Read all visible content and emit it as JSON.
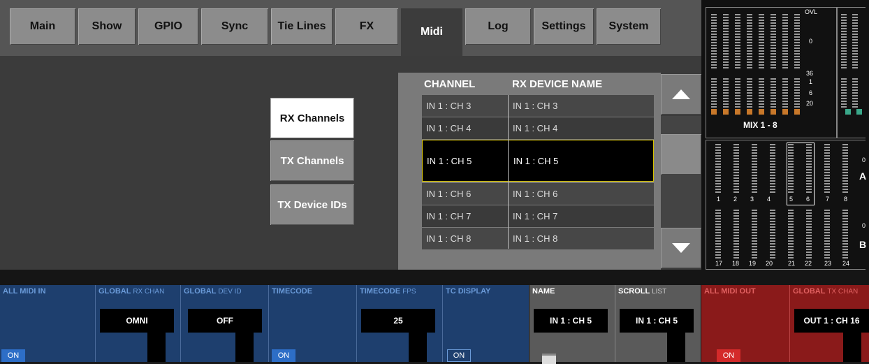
{
  "tabs": [
    "Main",
    "Show",
    "GPIO",
    "Sync",
    "Tie Lines",
    "FX",
    "Midi",
    "Log",
    "Settings",
    "System"
  ],
  "active_tab": "Midi",
  "side_buttons": [
    "RX Channels",
    "TX Channels",
    "TX Device IDs"
  ],
  "list": {
    "col_channel": "CHANNEL",
    "col_rx_name": "RX DEVICE NAME",
    "rows": [
      {
        "channel": "IN 1 : CH 3",
        "name": "IN 1 : CH 3"
      },
      {
        "channel": "IN 1 : CH 4",
        "name": "IN 1 : CH 4"
      },
      {
        "channel": "IN 1 : CH 5",
        "name": "IN 1 : CH 5"
      },
      {
        "channel": "IN 1 : CH 6",
        "name": "IN 1 : CH 6"
      },
      {
        "channel": "IN 1 : CH 7",
        "name": "IN 1 : CH 7"
      },
      {
        "channel": "IN 1 : CH 8",
        "name": "IN 1 : CH 8"
      }
    ],
    "selected_row": "IN 1 : CH 5"
  },
  "meters": {
    "mix_label": "MIX 1 - 8",
    "scale_top": [
      "OVL",
      "0",
      "36",
      "1",
      "6",
      "20"
    ],
    "row_a_nums": [
      "1",
      "2",
      "3",
      "4",
      "5",
      "6",
      "7",
      "8"
    ],
    "row_b_nums": [
      "17",
      "18",
      "19",
      "20",
      "21",
      "22",
      "23",
      "24"
    ],
    "row_a_letter": "A",
    "row_b_letter": "B",
    "tick_zero": "0"
  },
  "bottom": {
    "all_midi_in": "ALL MIDI IN",
    "global_rx_chan": "GLOBAL",
    "global_rx_chan_sub": "RX CHAN",
    "global_rx_chan_value": "OMNI",
    "global_dev_id": "GLOBAL",
    "global_dev_id_sub": "DEV ID",
    "global_dev_id_value": "OFF",
    "timecode": "TIMECODE",
    "timecode_fps": "TIMECODE",
    "timecode_fps_sub": "FPS",
    "timecode_fps_value": "25",
    "tc_display": "TC DISPLAY",
    "name": "NAME",
    "name_value": "IN 1 : CH 5",
    "scroll": "SCROLL",
    "scroll_sub": "LIST",
    "scroll_value": "IN 1 : CH 5",
    "all_midi_out": "ALL MIDI OUT",
    "global_tx": "GLOBAL",
    "global_tx_sub": "TX CHAN",
    "global_tx_value": "OUT 1 : CH 16",
    "on": "ON"
  },
  "colors": {
    "blue_panel": "#1e3f6e",
    "red_panel": "#8a1a1a",
    "grey_panel": "#5a5a5a",
    "accent_yellow": "#d8c400"
  }
}
